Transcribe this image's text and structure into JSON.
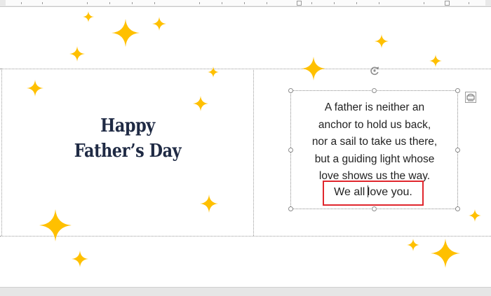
{
  "card": {
    "title_line1": "Happy",
    "title_line2": "Father’s Day",
    "poem_lines": [
      "A father is neither an",
      "anchor to hold us back,",
      "nor a sail to take us there,",
      "but a guiding light whose",
      "love shows us the way."
    ],
    "closing_before_cursor": "We all ",
    "closing_after_cursor": "love you."
  },
  "colors": {
    "star": "#FFC000",
    "title": "#1F2A44",
    "highlight_box": "#E0262D"
  },
  "icons": {
    "rotate_handle": "rotate-handle-icon",
    "layout_options": "layout-options-icon"
  }
}
